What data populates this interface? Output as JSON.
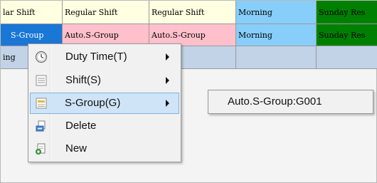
{
  "grid": {
    "row1": [
      "lar Shift",
      "Regular Shift",
      "Regular Shift",
      "Morning",
      "Sunday Res"
    ],
    "row2": [
      "S-Group",
      "Auto.S-Group",
      "Auto.S-Group",
      "Morning",
      "Sunday Res"
    ],
    "row3": [
      "ing",
      "",
      "",
      "",
      ""
    ]
  },
  "colors": {
    "cream": "#ffffe1",
    "blue_cell": "#1a77d6",
    "pink": "#ffc0cb",
    "light_blue": "#87cefa",
    "green": "#008000",
    "row3": "#c2d3e8"
  },
  "context_menu": {
    "items": [
      {
        "label": "Duty Time(T)",
        "icon": "clock-icon",
        "has_submenu": true
      },
      {
        "label": "Shift(S)",
        "icon": "list-icon",
        "has_submenu": true
      },
      {
        "label": "S-Group(G)",
        "icon": "group-icon",
        "has_submenu": true,
        "highlighted": true
      },
      {
        "label": "Delete",
        "icon": "delete-icon",
        "has_submenu": false
      },
      {
        "label": "New",
        "icon": "new-icon",
        "has_submenu": false
      }
    ]
  },
  "submenu": {
    "items": [
      {
        "label": "Auto.S-Group:G001"
      }
    ]
  }
}
